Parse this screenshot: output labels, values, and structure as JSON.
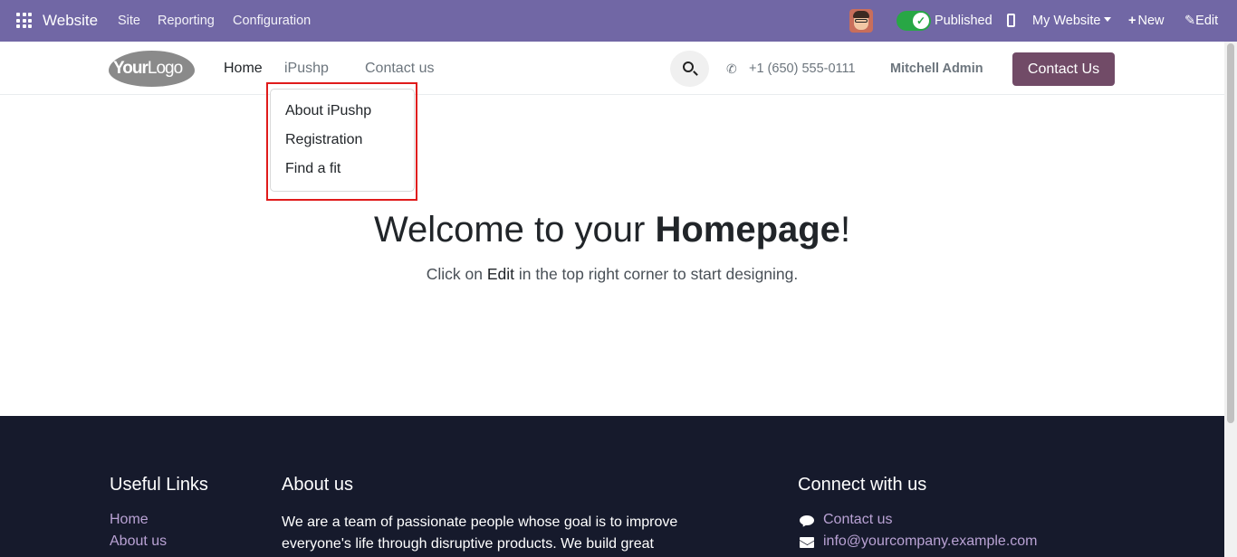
{
  "topbar": {
    "brand": "Website",
    "menu": [
      "Site",
      "Reporting",
      "Configuration"
    ],
    "published_label": "Published",
    "my_website_label": "My Website",
    "new_label": "New",
    "edit_label": "Edit",
    "bar_color": "#7167a5"
  },
  "header": {
    "logo_bold": "Your",
    "logo_light": "Logo",
    "nav": {
      "home": "Home",
      "ipushp": "iPushp",
      "contact": "Contact us"
    },
    "phone": "+1 (650) 555-0111",
    "user": "Mitchell Admin",
    "contact_button": "Contact Us",
    "accent_color": "#714b67"
  },
  "dropdown": {
    "items": [
      "About iPushp",
      "Registration",
      "Find a fit"
    ]
  },
  "hero": {
    "title_prefix": "Welcome to your ",
    "title_bold": "Homepage",
    "title_suffix": "!",
    "sub_prefix": "Click on ",
    "sub_bold": "Edit",
    "sub_suffix": " in the top right corner to start designing."
  },
  "footer": {
    "useful_links_title": "Useful Links",
    "useful_links": [
      "Home",
      "About us"
    ],
    "about_title": "About us",
    "about_text": "We are a team of passionate people whose goal is to improve everyone's life through disruptive products. We build great",
    "connect_title": "Connect with us",
    "connect_contact": "Contact us",
    "connect_email": "info@yourcompany.example.com",
    "bg_color": "#161a2c"
  }
}
